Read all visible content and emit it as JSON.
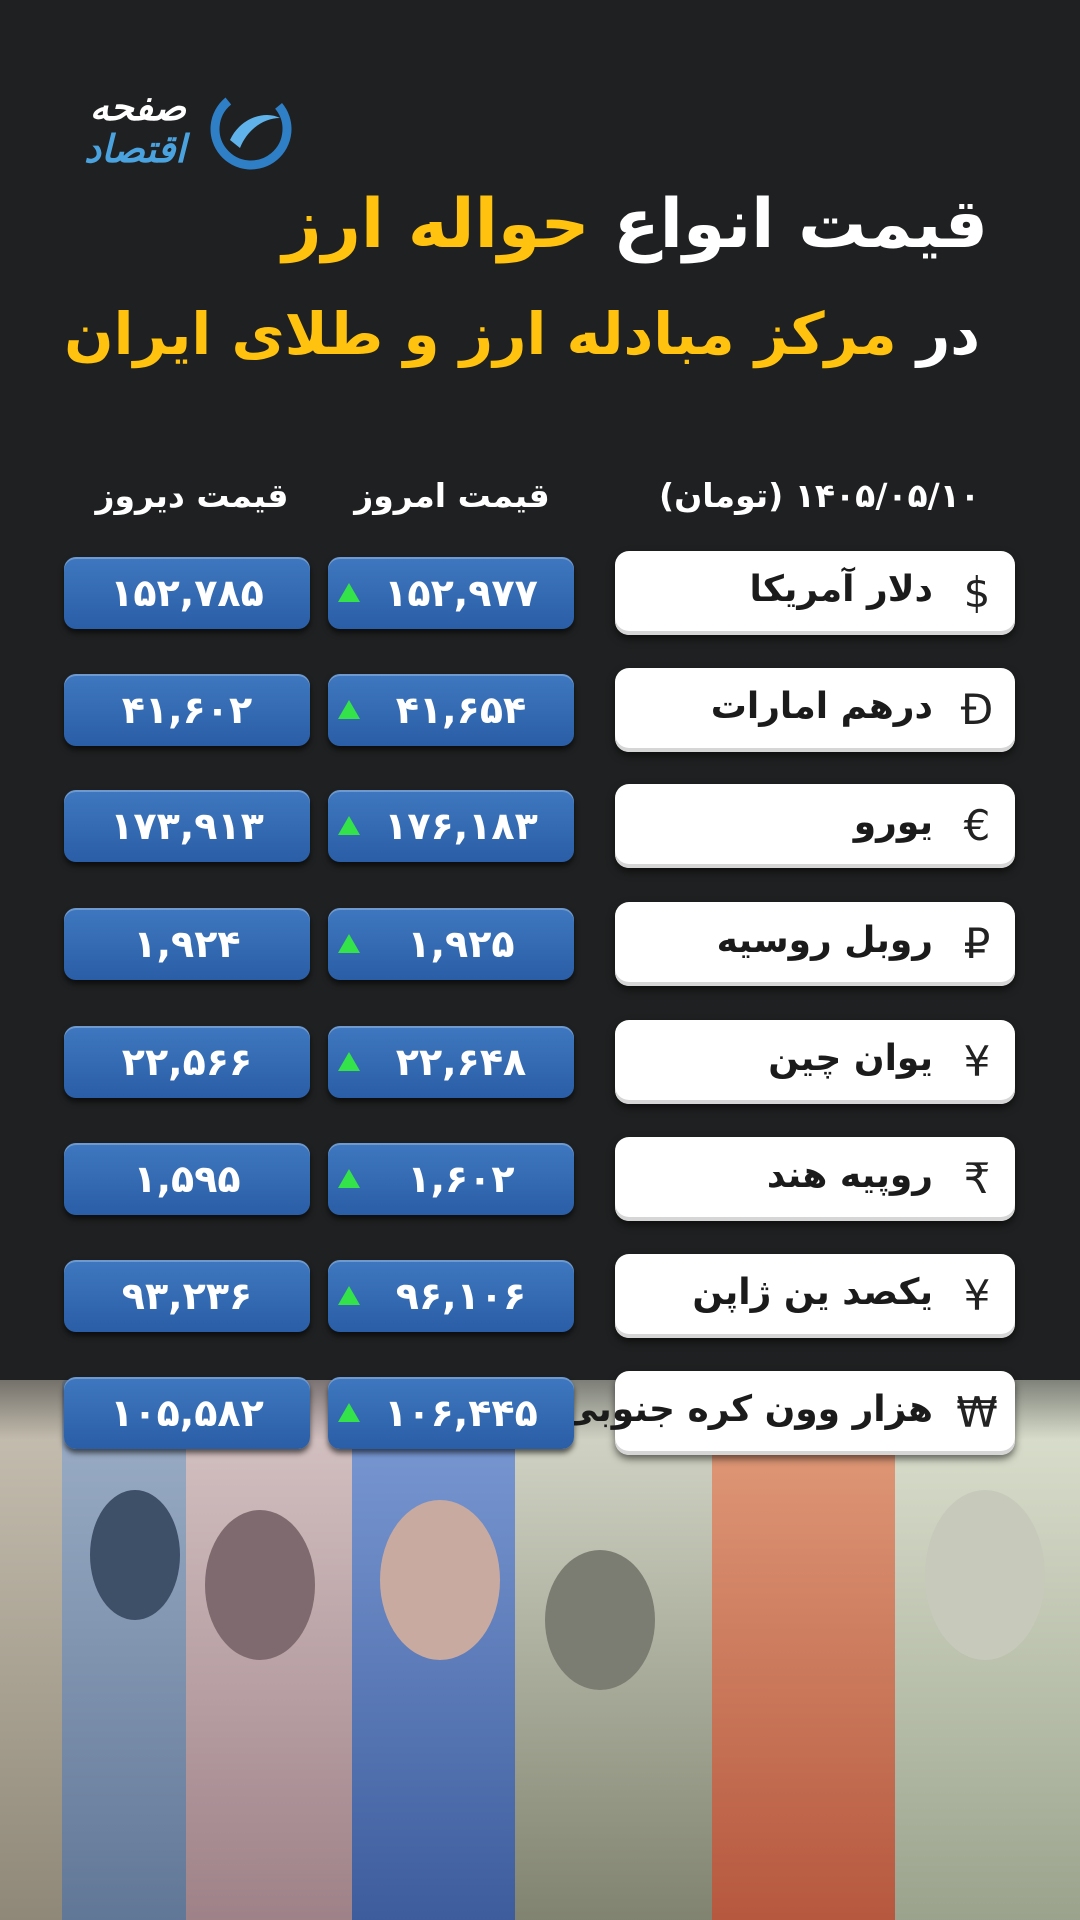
{
  "logo": {
    "line1": "صفحه",
    "line2": "اقتصاد"
  },
  "title": {
    "line1_white": "قیمت انواع",
    "line1_yellow": "حواله ارز",
    "line2_white": "در",
    "line2_yellow": "مرکز مبادله ارز و طلای ایران"
  },
  "headers": {
    "date": "۱۴۰۵/۰۵/۱۰ (تومان)",
    "today": "قیمت امروز",
    "yesterday": "قیمت دیروز"
  },
  "colors": {
    "background": "#1f2021",
    "accent": "#ffc20e",
    "price_box": "#2f64ab",
    "up": "#34e34a"
  },
  "rows": [
    {
      "symbol": "$",
      "name": "دلار آمریکا",
      "today": "۱۵۲,۹۷۷",
      "yesterday": "۱۵۲,۷۸۵",
      "trend": "up"
    },
    {
      "symbol": "Đ",
      "name": "درهم امارات",
      "today": "۴۱,۶۵۴",
      "yesterday": "۴۱,۶۰۲",
      "trend": "up"
    },
    {
      "symbol": "€",
      "name": "یورو",
      "today": "۱۷۶,۱۸۳",
      "yesterday": "۱۷۳,۹۱۳",
      "trend": "up"
    },
    {
      "symbol": "₽",
      "name": "روبل روسیه",
      "today": "۱,۹۲۵",
      "yesterday": "۱,۹۲۴",
      "trend": "up"
    },
    {
      "symbol": "¥",
      "name": "یوان چین",
      "today": "۲۲,۶۴۸",
      "yesterday": "۲۲,۵۶۶",
      "trend": "up"
    },
    {
      "symbol": "₹",
      "name": "روپیه هند",
      "today": "۱,۶۰۲",
      "yesterday": "۱,۵۹۵",
      "trend": "up"
    },
    {
      "symbol": "¥",
      "name": "یکصد ین ژاپن",
      "today": "۹۶,۱۰۶",
      "yesterday": "۹۳,۲۳۶",
      "trend": "up"
    },
    {
      "symbol": "₩",
      "name": "هزار وون کره جنوبی",
      "today": "۱۰۶,۴۴۵",
      "yesterday": "۱۰۵,۵۸۲",
      "trend": "up"
    }
  ]
}
